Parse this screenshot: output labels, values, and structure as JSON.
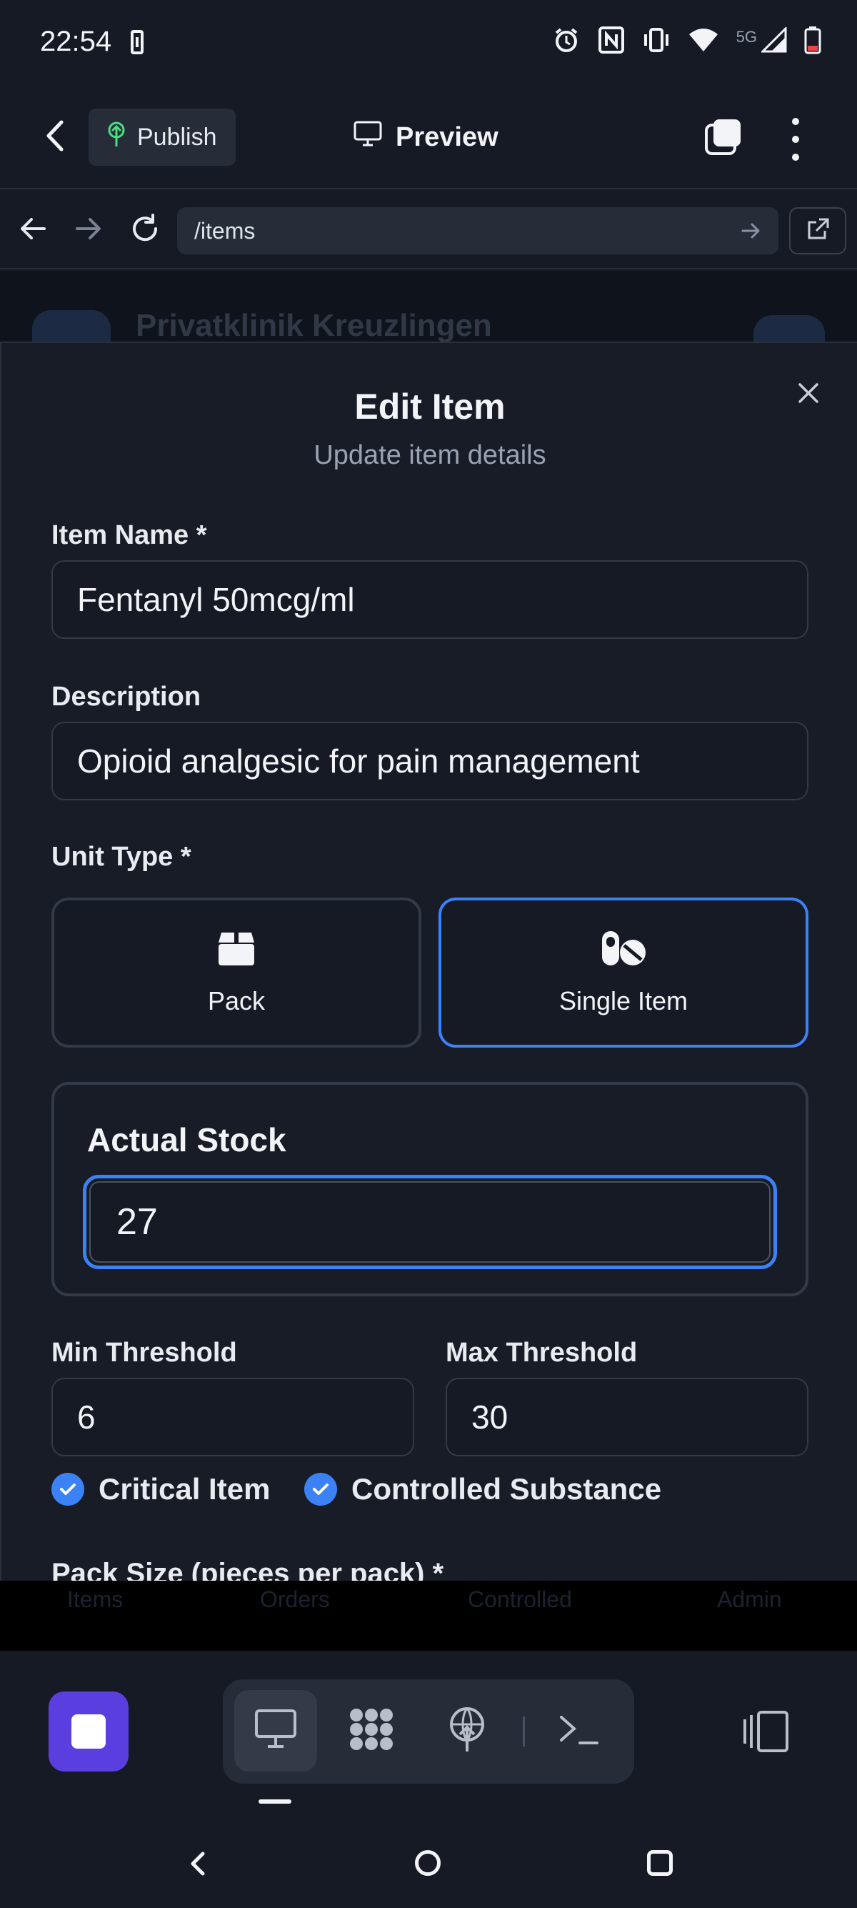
{
  "status_bar": {
    "time": "22:54",
    "network": "5G",
    "icons": [
      "alarm-icon",
      "nfc-icon",
      "vibrate-icon",
      "wifi-icon",
      "signal-icon",
      "battery-icon"
    ]
  },
  "editor": {
    "publish_label": "Publish",
    "preview_label": "Preview"
  },
  "browser": {
    "url": "/items"
  },
  "background_app": {
    "clinic_name": "Privatklinik Kreuzlingen",
    "tabs": [
      "Items",
      "Orders",
      "Controlled",
      "Admin"
    ]
  },
  "modal": {
    "title": "Edit Item",
    "subtitle": "Update item details",
    "item_name_label": "Item Name *",
    "item_name_value": "Fentanyl 50mcg/ml",
    "description_label": "Description",
    "description_value": "Opioid analgesic for pain management",
    "unit_type_label": "Unit Type *",
    "unit_options": [
      {
        "label": "Pack",
        "icon": "box-icon",
        "selected": false
      },
      {
        "label": "Single Item",
        "icon": "pills-icon",
        "selected": true
      }
    ],
    "actual_stock_label": "Actual Stock",
    "actual_stock_value": "27",
    "min_threshold_label": "Min Threshold",
    "min_threshold_value": "6",
    "max_threshold_label": "Max Threshold",
    "max_threshold_value": "30",
    "checkboxes": [
      {
        "label": "Critical Item",
        "checked": true
      },
      {
        "label": "Controlled Substance",
        "checked": true
      }
    ],
    "pack_size_label": "Pack Size (pieces per pack) *"
  },
  "colors": {
    "accent": "#3b82f6",
    "stop_button": "#5b3ee0",
    "publish_icon": "#4ade80"
  }
}
